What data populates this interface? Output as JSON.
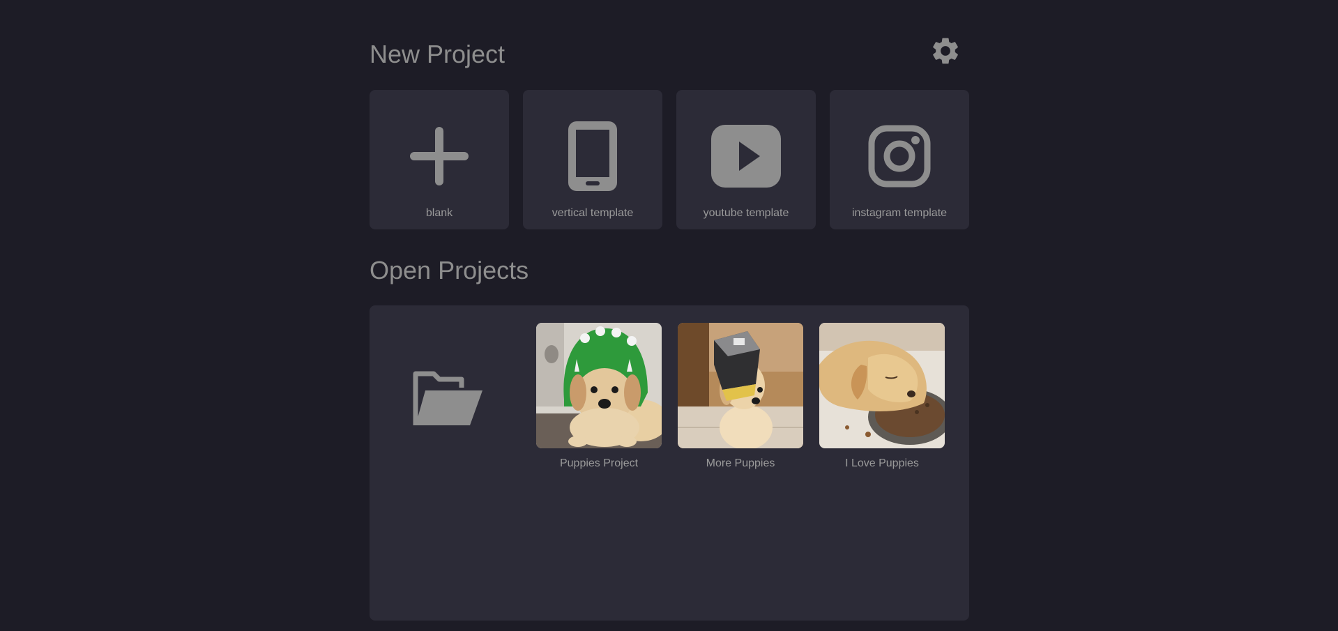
{
  "new_project": {
    "title": "New Project",
    "templates": [
      {
        "label": "blank",
        "icon": "plus-icon"
      },
      {
        "label": "vertical template",
        "icon": "phone-icon"
      },
      {
        "label": "youtube template",
        "icon": "youtube-icon"
      },
      {
        "label": "instagram template",
        "icon": "instagram-icon"
      }
    ]
  },
  "settings": {
    "icon": "gear-icon"
  },
  "open_projects": {
    "title": "Open Projects",
    "folder_icon": "folder-open-icon",
    "projects": [
      {
        "label": "Puppies Project",
        "thumbnail": "puppy-in-green-dinosaur-hood"
      },
      {
        "label": "More Puppies",
        "thumbnail": "puppy-with-box-on-head"
      },
      {
        "label": "I Love Puppies",
        "thumbnail": "puppy-sleeping-in-food-bowl"
      }
    ]
  },
  "colors": {
    "background": "#1d1c26",
    "panel": "#2c2b37",
    "icon": "#8e8e8e",
    "text": "#9a9a9a"
  }
}
